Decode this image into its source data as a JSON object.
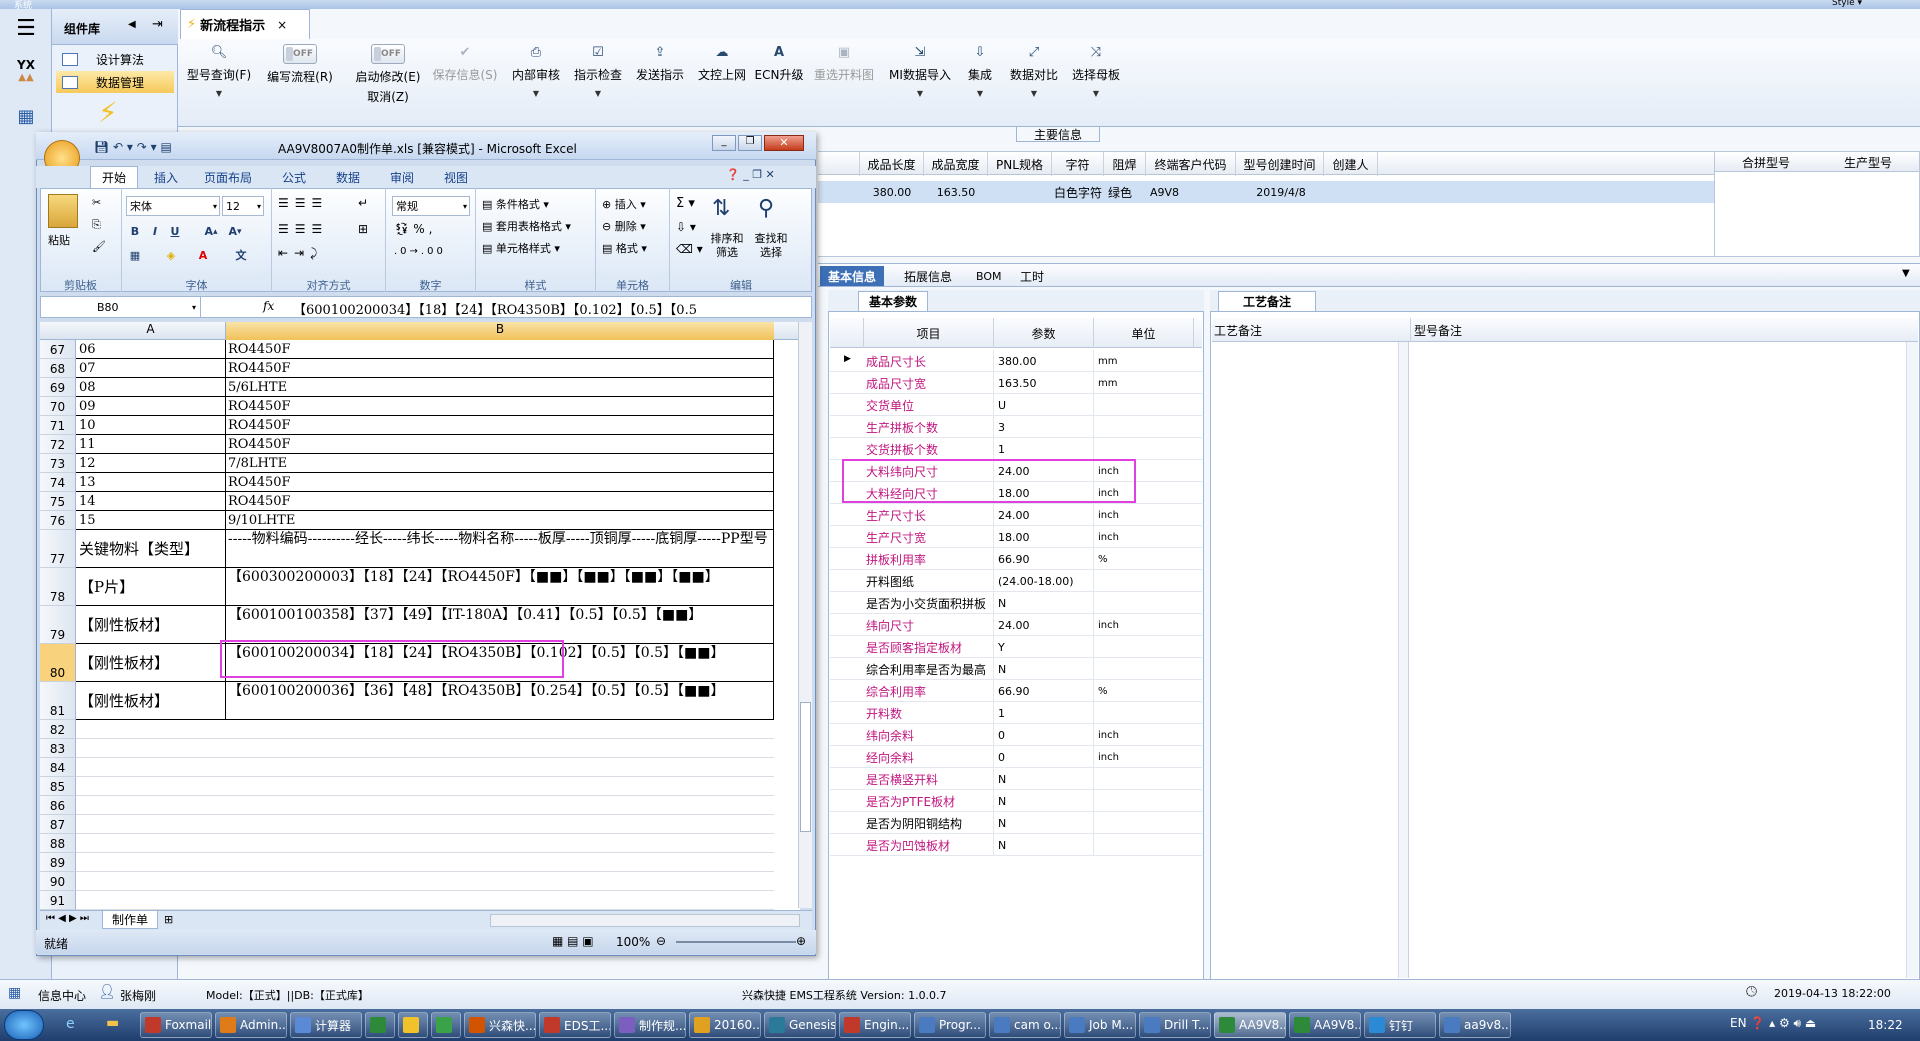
{
  "app": {
    "top_left_label": "系统",
    "top_right_label": "Style",
    "left_nav": {
      "yx_label": "YX"
    },
    "library": {
      "title": "组件库",
      "items": [
        "设计算法",
        "数据管理"
      ]
    },
    "doc_tab": "新流程指示"
  },
  "ribbon": {
    "buttons": [
      {
        "label": "型号查询(F)",
        "icon": "search-icon",
        "dropdown": true,
        "enabled": true
      },
      {
        "label": "编写流程(R)",
        "toggle": "OFF",
        "enabled": true
      },
      {
        "label": "启动修改(E)",
        "label2": "取消(Z)",
        "toggle": "OFF",
        "enabled": true
      },
      {
        "label": "保存信息(S)",
        "icon": "check-icon",
        "enabled": false
      },
      {
        "label": "内部审核",
        "icon": "printer-icon",
        "dropdown": true,
        "enabled": true
      },
      {
        "label": "指示检查",
        "icon": "checklist-icon",
        "dropdown": true,
        "enabled": true
      },
      {
        "label": "发送指示",
        "icon": "upload-icon",
        "enabled": true
      },
      {
        "label": "文控上网",
        "icon": "cloud-upload-icon",
        "enabled": true
      },
      {
        "label": "ECN升级",
        "icon": "letter-a-icon",
        "enabled": true
      },
      {
        "label": "重选开料图",
        "icon": "image-icon",
        "enabled": false
      },
      {
        "label": "MI数据导入",
        "icon": "import-icon",
        "dropdown": true,
        "enabled": true
      },
      {
        "label": "集成",
        "icon": "download-icon",
        "dropdown": true,
        "enabled": true
      },
      {
        "label": "数据对比",
        "icon": "compare-icon",
        "dropdown": true,
        "enabled": true
      },
      {
        "label": "选择母板",
        "icon": "shuffle-icon",
        "dropdown": true,
        "enabled": true
      }
    ]
  },
  "main_info": {
    "group_label": "主要信息",
    "columns": [
      "成品长度",
      "成品宽度",
      "PNL规格",
      "字符",
      "阻焊",
      "终端客户代码",
      "型号创建时间",
      "创建人"
    ],
    "row": {
      "成品长度": "380.00",
      "成品宽度": "163.50",
      "PNL规格": "",
      "字符": "白色字符",
      "阻焊": "绿色",
      "终端客户代码": "A9V8",
      "型号创建时间": "2019/4/8",
      "创建人": ""
    },
    "right_columns": [
      "合拼型号",
      "生产型号"
    ]
  },
  "bottom_tabs": [
    "基本信息",
    "拓展信息",
    "BOM",
    "工时"
  ],
  "params": {
    "panel_title": "基本参数",
    "headers": [
      "项目",
      "参数",
      "单位"
    ],
    "rows": [
      {
        "name": "成品尺寸长",
        "value": "380.00",
        "unit": "mm",
        "black": false
      },
      {
        "name": "成品尺寸宽",
        "value": "163.50",
        "unit": "mm",
        "black": false
      },
      {
        "name": "交货单位",
        "value": "U",
        "unit": "",
        "black": false
      },
      {
        "name": "生产拼板个数",
        "value": "3",
        "unit": "",
        "black": false
      },
      {
        "name": "交货拼板个数",
        "value": "1",
        "unit": "",
        "black": false
      },
      {
        "name": "大料纬向尺寸",
        "value": "24.00",
        "unit": "inch",
        "black": false
      },
      {
        "name": "大料经向尺寸",
        "value": "18.00",
        "unit": "inch",
        "black": false
      },
      {
        "name": "生产尺寸长",
        "value": "24.00",
        "unit": "inch",
        "black": false
      },
      {
        "name": "生产尺寸宽",
        "value": "18.00",
        "unit": "inch",
        "black": false
      },
      {
        "name": "拼板利用率",
        "value": "66.90",
        "unit": "%",
        "black": false
      },
      {
        "name": "开料图纸",
        "value": "(24.00-18.00)",
        "unit": "",
        "black": true
      },
      {
        "name": "是否为小交货面积拼板",
        "value": "N",
        "unit": "",
        "black": true
      },
      {
        "name": "纬向尺寸",
        "value": "24.00",
        "unit": "inch",
        "black": false
      },
      {
        "name": "是否顾客指定板材",
        "value": "Y",
        "unit": "",
        "black": false
      },
      {
        "name": "综合利用率是否为最高",
        "value": "N",
        "unit": "",
        "black": true
      },
      {
        "name": "综合利用率",
        "value": "66.90",
        "unit": "%",
        "black": false
      },
      {
        "name": "开料数",
        "value": "1",
        "unit": "",
        "black": false
      },
      {
        "name": "纬向余料",
        "value": "0",
        "unit": "inch",
        "black": false
      },
      {
        "name": "经向余料",
        "value": "0",
        "unit": "inch",
        "black": false
      },
      {
        "name": "是否横竖开料",
        "value": "N",
        "unit": "",
        "black": false
      },
      {
        "name": "是否为PTFE板材",
        "value": "N",
        "unit": "",
        "black": false
      },
      {
        "name": "是否为阴阳铜结构",
        "value": "N",
        "unit": "",
        "black": true
      },
      {
        "name": "是否为凹蚀板材",
        "value": "N",
        "unit": "",
        "black": false
      }
    ]
  },
  "process": {
    "panel_title": "工艺备注",
    "columns": [
      "工艺备注",
      "型号备注"
    ]
  },
  "excel": {
    "title": "AA9V8007A0制作单.xls [兼容模式] - Microsoft Excel",
    "tabs": [
      "开始",
      "插入",
      "页面布局",
      "公式",
      "数据",
      "审阅",
      "视图"
    ],
    "groups": [
      "剪贴板",
      "字体",
      "对齐方式",
      "数字",
      "样式",
      "单元格",
      "编辑"
    ],
    "paste_label": "粘贴",
    "font_name": "宋体",
    "font_size": "12",
    "number_format": "常规",
    "style_items": [
      "条件格式",
      "套用表格格式",
      "单元格样式"
    ],
    "cell_items": [
      "插入",
      "删除",
      "格式"
    ],
    "sort_label": "排序和筛选",
    "find_label": "查找和选择",
    "name_box": "B80",
    "fx": "fx",
    "formula": "【600100200034】【18】【24】【RO4350B】【0.102】【0.5】【0.5",
    "col_a": "A",
    "col_b": "B",
    "rows": [
      {
        "n": "67",
        "a": "06",
        "b": "RO4450F"
      },
      {
        "n": "68",
        "a": "07",
        "b": "RO4450F"
      },
      {
        "n": "69",
        "a": "08",
        "b": "5/6LHTE"
      },
      {
        "n": "70",
        "a": "09",
        "b": "RO4450F"
      },
      {
        "n": "71",
        "a": "10",
        "b": "RO4450F"
      },
      {
        "n": "72",
        "a": "11",
        "b": "RO4450F"
      },
      {
        "n": "73",
        "a": "12",
        "b": "7/8LHTE"
      },
      {
        "n": "74",
        "a": "13",
        "b": "RO4450F"
      },
      {
        "n": "75",
        "a": "14",
        "b": "RO4450F"
      },
      {
        "n": "76",
        "a": "15",
        "b": "9/10LHTE"
      },
      {
        "n": "77",
        "a": "关键物料【类型】",
        "b": "-----物料编码----------经长-----纬长-----物料名称-----板厚-----顶铜厚-----底铜厚-----PP型号"
      },
      {
        "n": "78",
        "a": "【P片】",
        "b": "【600300200003】【18】【24】【RO4450F】【■■】【■■】【■■】【■■】"
      },
      {
        "n": "79",
        "a": "【刚性板材】",
        "b": "【600100100358】【37】【49】【IT-180A】【0.41】【0.5】【0.5】【■■】"
      },
      {
        "n": "80",
        "a": "【刚性板材】",
        "b": "【600100200034】【18】【24】【RO4350B】【0.102】【0.5】【0.5】【■■】"
      },
      {
        "n": "81",
        "a": "【刚性板材】",
        "b": "【600100200036】【36】【48】【RO4350B】【0.254】【0.5】【0.5】【■■】"
      },
      {
        "n": "82",
        "a": "",
        "b": ""
      },
      {
        "n": "83",
        "a": "",
        "b": ""
      },
      {
        "n": "84",
        "a": "",
        "b": ""
      },
      {
        "n": "85",
        "a": "",
        "b": ""
      },
      {
        "n": "86",
        "a": "",
        "b": ""
      },
      {
        "n": "87",
        "a": "",
        "b": ""
      },
      {
        "n": "88",
        "a": "",
        "b": ""
      },
      {
        "n": "89",
        "a": "",
        "b": ""
      },
      {
        "n": "90",
        "a": "",
        "b": ""
      },
      {
        "n": "91",
        "a": "",
        "b": ""
      }
    ],
    "sheet_tab": "制作单",
    "status_ready": "就绪",
    "zoom": "100%"
  },
  "status_bar": {
    "info_center": "信息中心",
    "user": "张梅刚",
    "model_text": "Model:【正式】||DB:【正式库】",
    "system_name": "兴森快捷 EMS工程系统 Version: 1.0.0.7",
    "datetime": "2019-04-13 18:22:00"
  },
  "taskbar": {
    "items": [
      "Foxmail",
      "Admin...",
      "计算器",
      "",
      "",
      "",
      "兴森快...",
      "EDS工...",
      "制作规...",
      "20160...",
      "Genesis",
      "Engin...",
      "Progr...",
      "cam o...",
      "Job M...",
      "Drill T...",
      "AA9V8...",
      "AA9V8...",
      "钉钉",
      "aa9v8..."
    ],
    "clock": "18:22"
  },
  "colors": {
    "accent": "#3c6fb6",
    "highlight": "#e040e0",
    "param_label": "#c0167f"
  }
}
